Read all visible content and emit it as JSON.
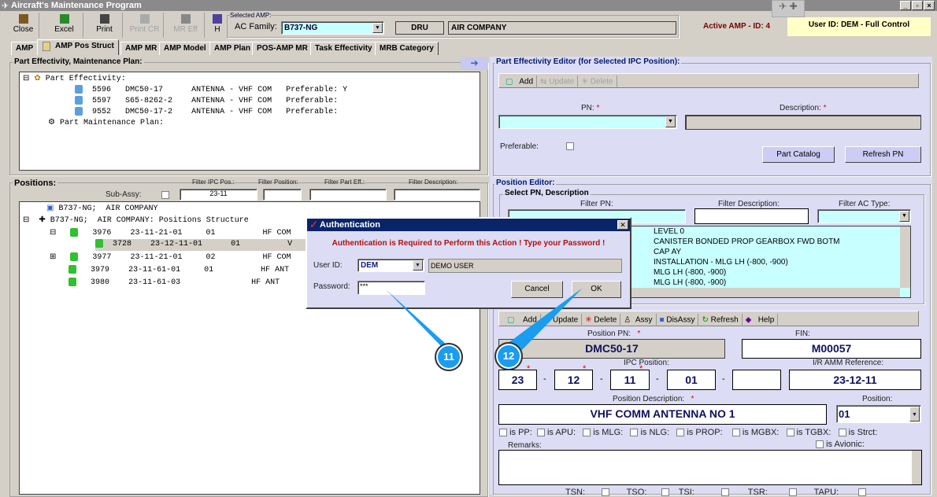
{
  "window": {
    "title": "Aircraft's Maintenance Program"
  },
  "toolbar": {
    "close": "Close",
    "excel": "Excel",
    "print": "Print",
    "print_cr": "Print CR",
    "mr_eff": "MR Eff",
    "help": "H"
  },
  "selected_amp": {
    "group_label": "Selected AMP:",
    "ac_family_label": "AC Family:",
    "ac_family_value": "B737-NG",
    "code": "DRU",
    "company": "AIR COMPANY"
  },
  "status": {
    "active_amp": "Active AMP - ID: 4",
    "user": "User ID: DEM - Full Control"
  },
  "tabs": [
    "AMP",
    "AMP Pos Struct",
    "AMP MR",
    "AMP Model",
    "AMP Plan",
    "POS-AMP MR",
    "Task Effectivity",
    "MRB Category"
  ],
  "part_eff": {
    "title": "Part Effectivity, Maintenance Plan:",
    "root": "Part Effectivity:",
    "items": [
      {
        "id": "5596",
        "pn": "DMC50-17",
        "desc": "ANTENNA - VHF COM",
        "pref": "Preferable: Y"
      },
      {
        "id": "5597",
        "pn": "S65-8262-2",
        "desc": "ANTENNA - VHF COM",
        "pref": "Preferable:"
      },
      {
        "id": "9552",
        "pn": "DMC50-17-2",
        "desc": "ANTENNA - VHF COM",
        "pref": "Preferable:"
      }
    ],
    "plan": "Part Maintenance Plan:"
  },
  "positions": {
    "title": "Positions:",
    "filter_ipc_label": "Filter IPC Pos.:",
    "filter_position_label": "Filter Position:",
    "filter_part_label": "Filter Part Eff.:",
    "filter_desc_label": "Filter Description:",
    "sub_assy_label": "Sub-Assy:",
    "filter_ipc_value": "23-11",
    "root1": "B737-NG;  AIR COMPANY",
    "root2": "B737-NG;  AIR COMPANY: Positions Structure",
    "rows": [
      {
        "id": "3976",
        "ipc": "23-11-21-01",
        "pos": "01",
        "desc": "HF COM"
      },
      {
        "id": "3728",
        "ipc": "23-12-11-01",
        "pos": "01",
        "desc": "V"
      },
      {
        "id": "3977",
        "ipc": "23-11-21-01",
        "pos": "02",
        "desc": "HF COM"
      },
      {
        "id": "3979",
        "ipc": "23-11-61-01",
        "pos": "01",
        "desc": "HF ANT"
      },
      {
        "id": "3980",
        "ipc": "23-11-61-03",
        "pos": "",
        "desc": "HF ANT"
      }
    ]
  },
  "pe_editor": {
    "title": "Part Effectivity Editor (for Selected IPC Position):",
    "add": "Add",
    "update": "Update",
    "delete": "Delete",
    "pn_label": "PN:",
    "desc_label": "Description:",
    "preferable_label": "Preferable:",
    "part_catalog": "Part Catalog",
    "refresh_pn": "Refresh PN",
    "req": "*"
  },
  "pos_editor": {
    "title": "Position Editor:",
    "select_title": "Select PN, Description",
    "filter_pn": "Filter PN:",
    "filter_desc": "Filter Description:",
    "filter_ac": "Filter AC Type:",
    "list": [
      "LEVEL 0",
      "CANISTER BONDED PROP GEARBOX FWD BOTM",
      "CAP AY",
      "INSTALLATION - MLG LH (-800, -900)",
      "MLG LH (-800, -900)",
      "MLG LH (-800, -900)"
    ],
    "tools": {
      "add": "Add",
      "update": "Update",
      "delete": "Delete",
      "assy": "Assy",
      "disassy": "DisAssy",
      "refresh": "Refresh",
      "help": "Help"
    },
    "position_pn_label": "Position PN:",
    "position_pn": "DMC50-17",
    "fin_label": "FIN:",
    "fin": "M00057",
    "ipc_label": "IPC Position:",
    "ipc": [
      "23",
      "12",
      "11",
      "01",
      ""
    ],
    "amm_label": "I/R AMM Reference:",
    "amm": "23-12-11",
    "pos_desc_label": "Position Description:",
    "pos_desc": "VHF COMM ANTENNA NO 1",
    "position_label": "Position:",
    "position": "01",
    "checks": [
      "is PP:",
      "is APU:",
      "is MLG:",
      "is NLG:",
      "is PROP:",
      "is MGBX:",
      "is TGBX:",
      "is Strct:"
    ],
    "avionic": "is Avionic:",
    "remarks_label": "Remarks:",
    "bottom": [
      "TSN:",
      "TSO:",
      "TSI:",
      "TSR:",
      "TAPU:"
    ]
  },
  "dialog": {
    "title": "Authentication",
    "message": "Authentication is Required to Perform this Action ! Type your Password !",
    "user_label": "User ID:",
    "user_value": "DEM",
    "user_name": "DEMO USER",
    "password_label": "Password:",
    "password_value": "***",
    "cancel": "Cancel",
    "ok": "OK"
  },
  "callouts": [
    "11",
    "12"
  ]
}
